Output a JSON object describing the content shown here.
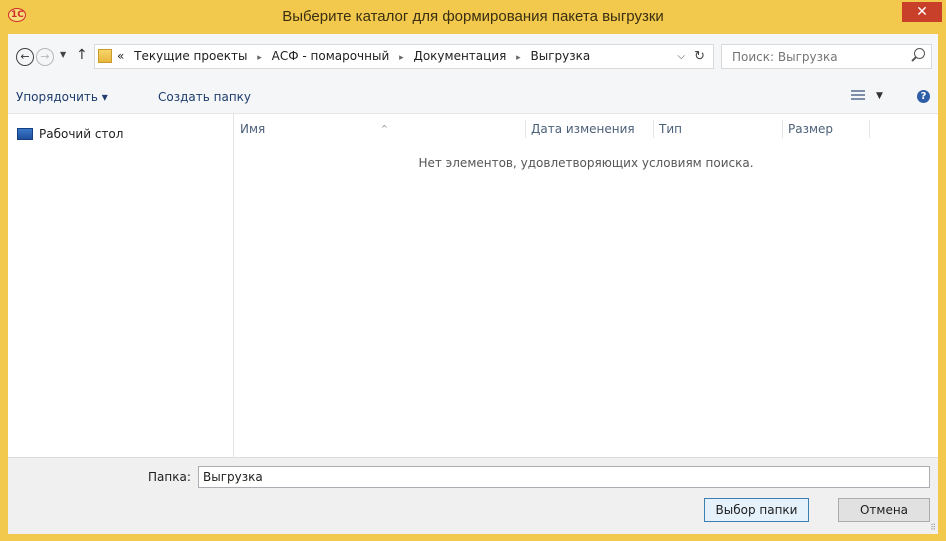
{
  "window": {
    "app_icon_text": "1С",
    "title": "Выберите каталог для формирования пакета выгрузки",
    "close_glyph": "✕"
  },
  "navigation": {
    "back_glyph": "←",
    "forward_glyph": "→",
    "history_glyph": "▼",
    "up_glyph": "↑"
  },
  "address": {
    "overflow": "«",
    "breadcrumbs": [
      "Текущие проекты",
      "АСФ - помарочный",
      "Документация",
      "Выгрузка"
    ],
    "separator": "▸",
    "dropdown_glyph": "⌵",
    "refresh_glyph": "↻"
  },
  "search": {
    "placeholder": "Поиск: Выгрузка"
  },
  "toolbar": {
    "organize_label": "Упорядочить ▾",
    "new_folder_label": "Создать папку",
    "view_drop_glyph": "▼",
    "help_glyph": "?"
  },
  "nav_pane": {
    "items": [
      {
        "label": "Рабочий стол",
        "icon": "desktop-icon"
      }
    ]
  },
  "file_list": {
    "sort_glyph": "^",
    "columns": [
      "Имя",
      "Дата изменения",
      "Тип",
      "Размер"
    ],
    "empty_message": "Нет элементов, удовлетворяющих условиям поиска."
  },
  "footer": {
    "folder_label": "Папка:",
    "folder_value": "Выгрузка",
    "select_button": "Выбор папки",
    "cancel_button": "Отмена",
    "grip_glyph": "⠿"
  },
  "colors": {
    "titlebar": "#f2c94c",
    "close_button": "#c8402a",
    "primary_button_border": "#3c7fb1"
  }
}
